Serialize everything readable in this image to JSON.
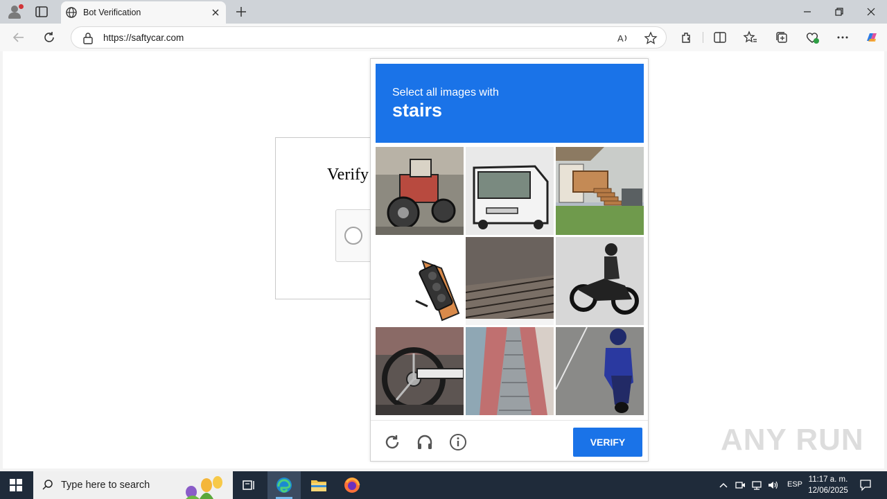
{
  "browser": {
    "tab_title": "Bot Verification",
    "url": "https://saftycar.com"
  },
  "page": {
    "verify_heading": "Verify",
    "watermark": "ANY RUN"
  },
  "captcha": {
    "instruction": "Select all images with",
    "target": "stairs",
    "tiles": [
      {
        "label": "tractor"
      },
      {
        "label": "bus"
      },
      {
        "label": "porch-stairs"
      },
      {
        "label": "traffic-light"
      },
      {
        "label": "stairs"
      },
      {
        "label": "motorcycle"
      },
      {
        "label": "motorcycle-wheel"
      },
      {
        "label": "stairway"
      },
      {
        "label": "scooter"
      }
    ],
    "verify_label": "VERIFY",
    "accent_color": "#1a73e8"
  },
  "taskbar": {
    "search_placeholder": "Type here to search",
    "language": "ESP",
    "time": "11:17 a. m.",
    "date": "12/06/2025"
  }
}
